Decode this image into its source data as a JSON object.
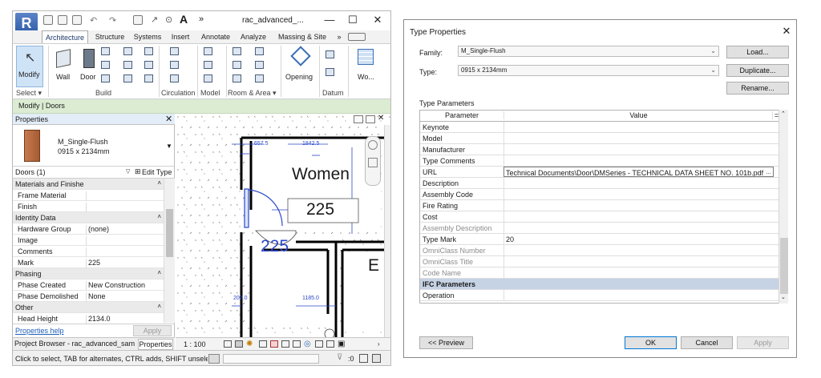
{
  "revit": {
    "logo": "R",
    "title": "rac_advanced_...",
    "window": {
      "minimize": "—",
      "maximize": "☐",
      "close": "✕"
    },
    "tabs": [
      "Architecture",
      "Structure",
      "Systems",
      "Insert",
      "Annotate",
      "Analyze",
      "Massing & Site"
    ],
    "tab_overflow": "»",
    "ribbon": {
      "modify_label": "Modify",
      "wall_label": "Wall",
      "door_label": "Door",
      "opening_label": "Opening",
      "wo_label": "Wo...",
      "panels": [
        "Select ▾",
        "Build",
        "Circulation",
        "Model",
        "Room & Area ▾",
        "Datum"
      ]
    },
    "modify_context": "Modify | Doors",
    "properties": {
      "title": "Properties",
      "type_name": "M_Single-Flush",
      "type_size": "0915 x 2134mm",
      "instance_filter": "Doors (1)",
      "edit_type": "Edit Type",
      "rows": [
        {
          "name": "Materials and Finishes",
          "value": "",
          "group": true
        },
        {
          "name": "Frame Material",
          "value": "",
          "group": false
        },
        {
          "name": "Finish",
          "value": "",
          "group": false
        },
        {
          "name": "Identity Data",
          "value": "",
          "group": true
        },
        {
          "name": "Hardware Group",
          "value": "(none)",
          "group": false
        },
        {
          "name": "Image",
          "value": "",
          "group": false
        },
        {
          "name": "Comments",
          "value": "",
          "group": false
        },
        {
          "name": "Mark",
          "value": "225",
          "group": false
        },
        {
          "name": "Phasing",
          "value": "",
          "group": true
        },
        {
          "name": "Phase Created",
          "value": "New Construction",
          "group": false
        },
        {
          "name": "Phase Demolished",
          "value": "None",
          "group": false
        },
        {
          "name": "Other",
          "value": "",
          "group": true
        },
        {
          "name": "Head Height",
          "value": "2134.0",
          "group": false
        }
      ],
      "help_link": "Properties help",
      "apply": "Apply"
    },
    "canvas": {
      "room_name": "Women",
      "room_number": "225",
      "door_tag": "225",
      "dim_top_left": "657.5",
      "dim_top_right": "1842.5",
      "dim_bottom": "1185.0",
      "dim_left": "202.0",
      "partial_room": "E"
    },
    "bottom_tabs": [
      "Project Browser - rac_advanced_sampl...",
      "Properties"
    ],
    "view_scale": "1 : 100",
    "status": "Click to select, TAB for alternates, CTRL adds, SHIFT unselects.",
    "status_filter_count": ":0"
  },
  "dialog": {
    "title": "Type Properties",
    "close": "✕",
    "family_label": "Family:",
    "family_value": "M_Single-Flush",
    "type_label": "Type:",
    "type_value": "0915 x 2134mm",
    "load": "Load...",
    "duplicate": "Duplicate...",
    "rename": "Rename...",
    "section_title": "Type Parameters",
    "col_parameter": "Parameter",
    "col_value": "Value",
    "rows": [
      {
        "name": "Keynote",
        "value": "",
        "kind": "normal"
      },
      {
        "name": "Model",
        "value": "",
        "kind": "normal"
      },
      {
        "name": "Manufacturer",
        "value": "",
        "kind": "normal"
      },
      {
        "name": "Type Comments",
        "value": "",
        "kind": "normal"
      },
      {
        "name": "URL",
        "value": "Technical Documents\\Door\\DMSeries - TECHNICAL DATA SHEET NO. 101b.pdf",
        "kind": "selected"
      },
      {
        "name": "Description",
        "value": "",
        "kind": "normal"
      },
      {
        "name": "Assembly Code",
        "value": "",
        "kind": "normal"
      },
      {
        "name": "Fire Rating",
        "value": "",
        "kind": "normal"
      },
      {
        "name": "Cost",
        "value": "",
        "kind": "normal"
      },
      {
        "name": "Assembly Description",
        "value": "",
        "kind": "disabled"
      },
      {
        "name": "Type Mark",
        "value": "20",
        "kind": "normal"
      },
      {
        "name": "OmniClass Number",
        "value": "",
        "kind": "disabled"
      },
      {
        "name": "OmniClass Title",
        "value": "",
        "kind": "disabled"
      },
      {
        "name": "Code Name",
        "value": "",
        "kind": "disabled"
      },
      {
        "name": "IFC Parameters",
        "value": "",
        "kind": "group"
      },
      {
        "name": "Operation",
        "value": "",
        "kind": "normal"
      }
    ],
    "ellipsis": "...",
    "preview": "<< Preview",
    "ok": "OK",
    "cancel": "Cancel",
    "apply": "Apply"
  },
  "colors": {
    "accent": "#0078d7",
    "revit_blue": "#2f5ca8",
    "context_green": "#dbecd2",
    "group_row": "#c6d3e5"
  }
}
